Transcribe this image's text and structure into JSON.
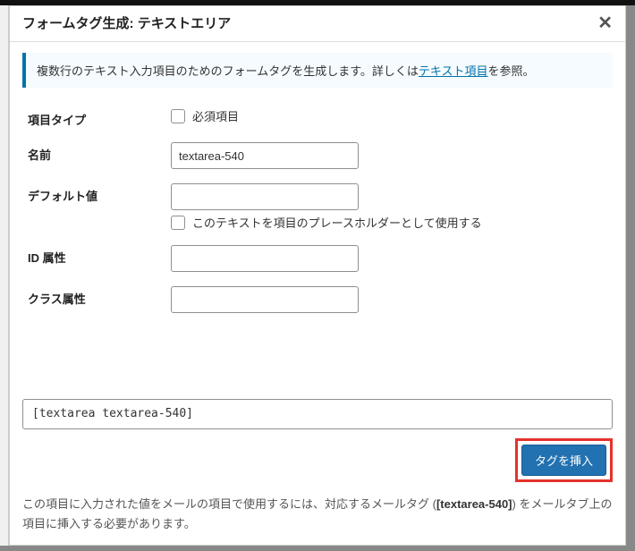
{
  "header": {
    "title": "フォームタグ生成: テキストエリア",
    "close": "✕"
  },
  "info": {
    "text_before_link": "複数行のテキスト入力項目のためのフォームタグを生成します。詳しくは",
    "link_text": "テキスト項目",
    "text_after_link": "を参照。"
  },
  "fields": {
    "field_type": {
      "label": "項目タイプ",
      "required_label": "必須項目"
    },
    "name": {
      "label": "名前",
      "value": "textarea-540"
    },
    "default_value": {
      "label": "デフォルト値",
      "value": "",
      "placeholder_label": "このテキストを項目のプレースホルダーとして使用する"
    },
    "id_attr": {
      "label": "ID 属性",
      "value": ""
    },
    "class_attr": {
      "label": "クラス属性",
      "value": ""
    }
  },
  "output": {
    "tag": "[textarea textarea-540]"
  },
  "actions": {
    "insert": "タグを挿入"
  },
  "help": {
    "before": "この項目に入力された値をメールの項目で使用するには、対応するメールタグ (",
    "mailtag": "[textarea-540]",
    "after": ") をメールタブ上の項目に挿入する必要があります。"
  }
}
